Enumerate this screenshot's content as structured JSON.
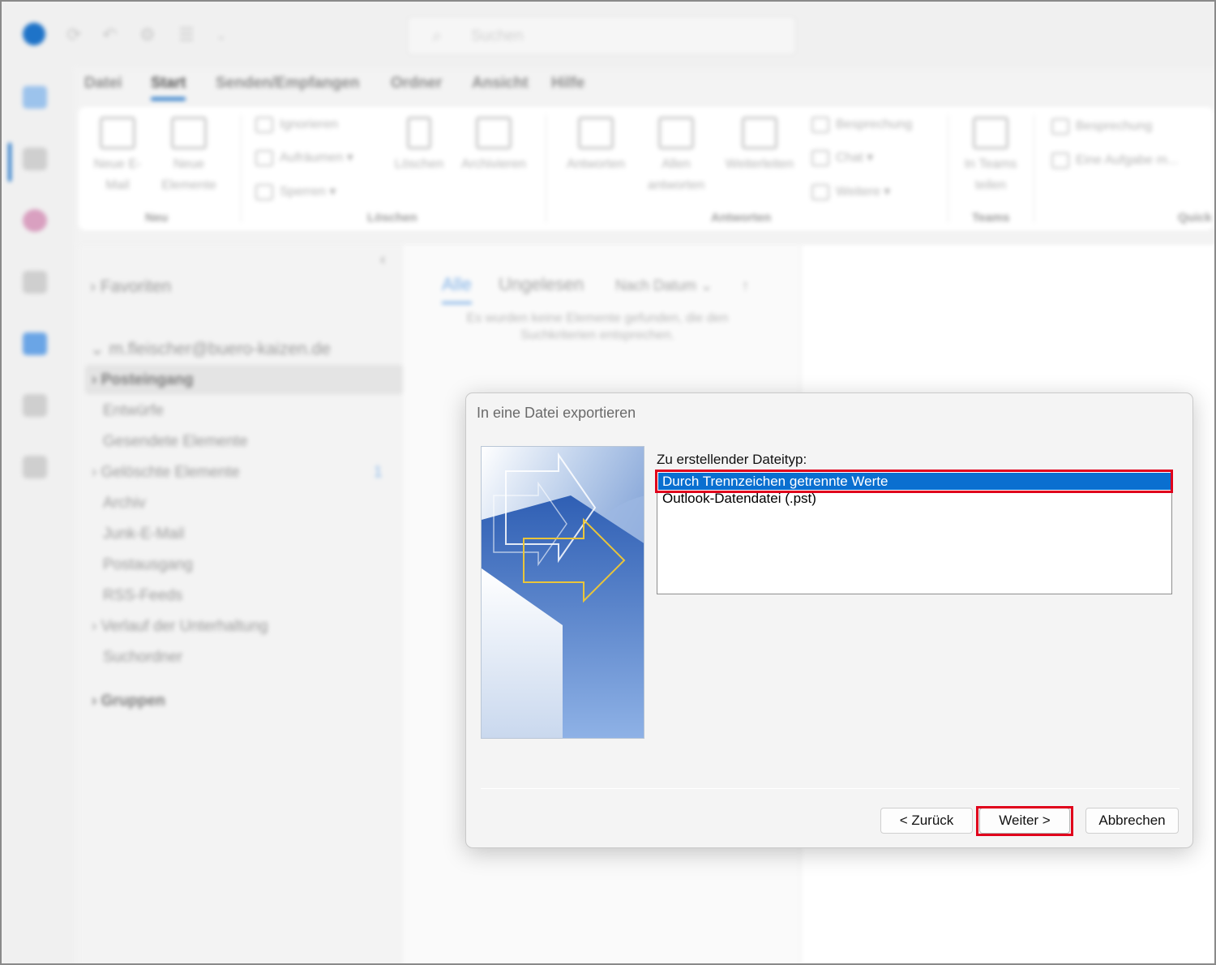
{
  "colors": {
    "accent": "#1e73c8",
    "selection": "#0a6fd0",
    "highlight_box": "#e0001b"
  },
  "background_app": {
    "search_placeholder": "Suchen",
    "menu_tabs": [
      "Datei",
      "Start",
      "Senden/Empfangen",
      "Ordner",
      "Ansicht",
      "Hilfe"
    ],
    "active_tab": "Start",
    "ribbon": {
      "new_mail": "Neue E-Mail",
      "new_items": "Neue Elemente",
      "ignore": "Ignorieren",
      "cleanup": "Aufräumen",
      "block": "Sperren",
      "delete": "Löschen",
      "archive": "Archivieren",
      "reply": "Antworten",
      "reply_all": "Allen antworten",
      "forward": "Weiterleiten",
      "meeting": "Besprechung",
      "chat": "Chat",
      "more": "Weitere",
      "share_teams": "In Teams teilen",
      "meeting2": "Besprechung",
      "task": "Eine Aufgabe m...",
      "group_new": "Neu",
      "group_delete": "Löschen",
      "group_respond": "Antworten",
      "group_teams": "Teams",
      "group_quick": "Quick"
    },
    "folders": {
      "favorites": "Favoriten",
      "account": "m.fleischer@buero-kaizen.de",
      "items": [
        "Posteingang",
        "Entwürfe",
        "Gesendete Elemente",
        "Gelöschte Elemente",
        "Archiv",
        "Junk-E-Mail",
        "Postausgang",
        "RSS-Feeds",
        "Verlauf der Unterhaltung",
        "Suchordner"
      ],
      "deleted_count": "1",
      "groups": "Gruppen"
    },
    "message_list": {
      "tab_all": "Alle",
      "tab_unread": "Ungelesen",
      "sort": "Nach Datum",
      "empty": "Es wurden keine Elemente gefunden, die den Suchkriterien entsprechen."
    }
  },
  "dialog": {
    "title": "In eine Datei exportieren",
    "file_type_label": "Zu erstellender Dateityp:",
    "options": [
      "Durch Trennzeichen getrennte Werte",
      "Outlook-Datendatei (.pst)"
    ],
    "selected_index": 0,
    "buttons": {
      "back": "< Zurück",
      "next": "Weiter >",
      "cancel": "Abbrechen"
    }
  }
}
